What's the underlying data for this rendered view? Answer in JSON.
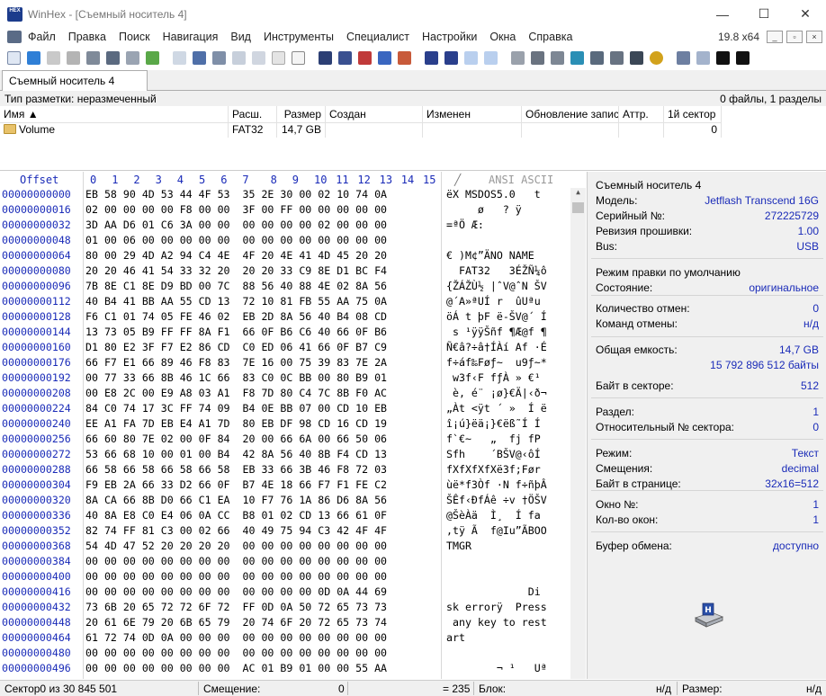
{
  "window": {
    "logo_text": "HEX",
    "title": "WinHex - [Съемный носитель 4]",
    "minimize": "—",
    "maximize": "☐",
    "close": "✕"
  },
  "menu": {
    "items": [
      "Файл",
      "Правка",
      "Поиск",
      "Навигация",
      "Вид",
      "Инструменты",
      "Специалист",
      "Настройки",
      "Окна",
      "Справка"
    ],
    "zoom": "19.8 x64"
  },
  "tab": {
    "label": "Съемный носитель 4"
  },
  "partition": {
    "type_label": "Тип разметки: неразмеченный",
    "summary": "0 файлы, 1 разделы"
  },
  "dirlist": {
    "columns": [
      "Имя ▲",
      "Расш.",
      "Размер",
      "Создан",
      "Изменен",
      "Обновление записи",
      "Аттр.",
      "1й сектор ▲"
    ],
    "row": {
      "name": "Volume",
      "ext": "FAT32",
      "size": "14,7 GB",
      "first_sector": "0"
    }
  },
  "hex": {
    "offset_header": "Offset",
    "column_headers": [
      "0",
      "1",
      "2",
      "3",
      "4",
      "5",
      "6",
      "7",
      "8",
      "9",
      "10",
      "11",
      "12",
      "13",
      "14",
      "15"
    ],
    "ascii_header": "ANSI ASCII",
    "rows": [
      {
        "off": "00000000000",
        "hex": "EB 58 90 4D 53 44 4F 53  35 2E 30 00 02 10 74 0A",
        "asc": "ëX MSDOS5.0   t"
      },
      {
        "off": "00000000016",
        "hex": "02 00 00 00 00 F8 00 00  3F 00 FF 00 00 00 00 00",
        "asc": "     ø   ? ÿ"
      },
      {
        "off": "00000000032",
        "hex": "3D AA D6 01 C6 3A 00 00  00 00 00 00 02 00 00 00",
        "asc": "=ªÖ Æ:"
      },
      {
        "off": "00000000048",
        "hex": "01 00 06 00 00 00 00 00  00 00 00 00 00 00 00 00",
        "asc": ""
      },
      {
        "off": "00000000064",
        "hex": "80 00 29 4D A2 94 C4 4E  4F 20 4E 41 4D 45 20 20",
        "asc": "€ )M¢”ÄNO NAME"
      },
      {
        "off": "00000000080",
        "hex": "20 20 46 41 54 33 32 20  20 20 33 C9 8E D1 BC F4",
        "asc": "  FAT32   3ÉŽÑ¼ô"
      },
      {
        "off": "00000000096",
        "hex": "7B 8E C1 8E D9 BD 00 7C  88 56 40 88 4E 02 8A 56",
        "asc": "{ŽÁŽÙ½ |ˆV@ˆN ŠV"
      },
      {
        "off": "00000000112",
        "hex": "40 B4 41 BB AA 55 CD 13  72 10 81 FB 55 AA 75 0A",
        "asc": "@´A»ªUÍ r  ûUªu"
      },
      {
        "off": "00000000128",
        "hex": "F6 C1 01 74 05 FE 46 02  EB 2D 8A 56 40 B4 08 CD",
        "asc": "öÁ t þF ë-ŠV@´ Í"
      },
      {
        "off": "00000000144",
        "hex": "13 73 05 B9 FF FF 8A F1  66 0F B6 C6 40 66 0F B6",
        "asc": " s ¹ÿÿŠñf ¶Æ@f ¶"
      },
      {
        "off": "00000000160",
        "hex": "D1 80 E2 3F F7 E2 86 CD  C0 ED 06 41 66 0F B7 C9",
        "asc": "Ñ€â?÷â†ÍÀí Af ·É"
      },
      {
        "off": "00000000176",
        "hex": "66 F7 E1 66 89 46 F8 83  7E 16 00 75 39 83 7E 2A",
        "asc": "f÷áf‰Føƒ~  u9ƒ~*"
      },
      {
        "off": "00000000192",
        "hex": "00 77 33 66 8B 46 1C 66  83 C0 0C BB 00 80 B9 01",
        "asc": " w3f‹F fƒÀ » €¹"
      },
      {
        "off": "00000000208",
        "hex": "00 E8 2C 00 E9 A8 03 A1  F8 7D 80 C4 7C 8B F0 AC",
        "asc": " è, é¨ ¡ø}€Ä|‹ð¬"
      },
      {
        "off": "00000000224",
        "hex": "84 C0 74 17 3C FF 74 09  B4 0E BB 07 00 CD 10 EB",
        "asc": "„Àt <ÿt ´ »  Í ë"
      },
      {
        "off": "00000000240",
        "hex": "EE A1 FA 7D EB E4 A1 7D  80 EB DF 98 CD 16 CD 19",
        "asc": "î¡ú}ëä¡}€ëß˜Í Í"
      },
      {
        "off": "00000000256",
        "hex": "66 60 80 7E 02 00 0F 84  20 00 66 6A 00 66 50 06",
        "asc": "f`€~   „  fj fP"
      },
      {
        "off": "00000000272",
        "hex": "53 66 68 10 00 01 00 B4  42 8A 56 40 8B F4 CD 13",
        "asc": "Sfh    ´BŠV@‹ôÍ"
      },
      {
        "off": "00000000288",
        "hex": "66 58 66 58 66 58 66 58  EB 33 66 3B 46 F8 72 03",
        "asc": "fXfXfXfXë3f;Før"
      },
      {
        "off": "00000000304",
        "hex": "F9 EB 2A 66 33 D2 66 0F  B7 4E 18 66 F7 F1 FE C2",
        "asc": "ùë*f3Òf ·N f÷ñþÂ"
      },
      {
        "off": "00000000320",
        "hex": "8A CA 66 8B D0 66 C1 EA  10 F7 76 1A 86 D6 8A 56",
        "asc": "ŠÊf‹ÐfÁê ÷v †ÖŠV"
      },
      {
        "off": "00000000336",
        "hex": "40 8A E8 C0 E4 06 0A CC  B8 01 02 CD 13 66 61 0F",
        "asc": "@ŠèÀä  Ì¸  Í fa"
      },
      {
        "off": "00000000352",
        "hex": "82 74 FF 81 C3 00 02 66  40 49 75 94 C3 42 4F 4F",
        "asc": "‚tÿ Ã  f@Iu”ÃBOO"
      },
      {
        "off": "00000000368",
        "hex": "54 4D 47 52 20 20 20 20  00 00 00 00 00 00 00 00",
        "asc": "TMGR"
      },
      {
        "off": "00000000384",
        "hex": "00 00 00 00 00 00 00 00  00 00 00 00 00 00 00 00",
        "asc": ""
      },
      {
        "off": "00000000400",
        "hex": "00 00 00 00 00 00 00 00  00 00 00 00 00 00 00 00",
        "asc": ""
      },
      {
        "off": "00000000416",
        "hex": "00 00 00 00 00 00 00 00  00 00 00 00 0D 0A 44 69",
        "asc": "             Di"
      },
      {
        "off": "00000000432",
        "hex": "73 6B 20 65 72 72 6F 72  FF 0D 0A 50 72 65 73 73",
        "asc": "sk errorÿ  Press"
      },
      {
        "off": "00000000448",
        "hex": "20 61 6E 79 20 6B 65 79  20 74 6F 20 72 65 73 74",
        "asc": " any key to rest"
      },
      {
        "off": "00000000464",
        "hex": "61 72 74 0D 0A 00 00 00  00 00 00 00 00 00 00 00",
        "asc": "art"
      },
      {
        "off": "00000000480",
        "hex": "00 00 00 00 00 00 00 00  00 00 00 00 00 00 00 00",
        "asc": ""
      },
      {
        "off": "00000000496",
        "hex": "00 00 00 00 00 00 00 00  AC 01 B9 01 00 00 55 AA",
        "asc": "        ¬ ¹   Uª"
      }
    ]
  },
  "info": {
    "title": "Съемный носитель 4",
    "rows": [
      {
        "label": "Модель:",
        "value": "Jetflash Transcend 16G"
      },
      {
        "label": "Серийный №:",
        "value": "272225729"
      },
      {
        "label": "Ревизия прошивки:",
        "value": "1.00"
      },
      {
        "label": "Bus:",
        "value": "USB"
      },
      {
        "label": "Режим правки по умолчанию",
        "value": ""
      },
      {
        "label": "Состояние:",
        "value": "оригинальное"
      },
      {
        "label": "Количество отмен:",
        "value": "0"
      },
      {
        "label": "Команд отмены:",
        "value": "н/д"
      },
      {
        "label": "Общая емкость:",
        "value": "14,7 GB"
      },
      {
        "label": "",
        "value": "15 792 896 512 байты"
      },
      {
        "label": "Байт в секторе:",
        "value": "512"
      },
      {
        "label": "Раздел:",
        "value": "1"
      },
      {
        "label": "Относительный № сектора:",
        "value": "0"
      },
      {
        "label": "Режим:",
        "value": "Текст"
      },
      {
        "label": "Смещения:",
        "value": "decimal"
      },
      {
        "label": "Байт в странице:",
        "value": "32x16=512"
      },
      {
        "label": "Окно №:",
        "value": "1"
      },
      {
        "label": "Кол-во окон:",
        "value": "1"
      },
      {
        "label": "Буфер обмена:",
        "value": "доступно"
      }
    ]
  },
  "status": {
    "sector": "Сектор0 из 30 845 501",
    "offset_label": "Смещение:",
    "offset_value": "0",
    "value": "= 235",
    "block_label": "Блок:",
    "block_value": "н/д",
    "size_label": "Размер:",
    "size_value": "н/д"
  }
}
